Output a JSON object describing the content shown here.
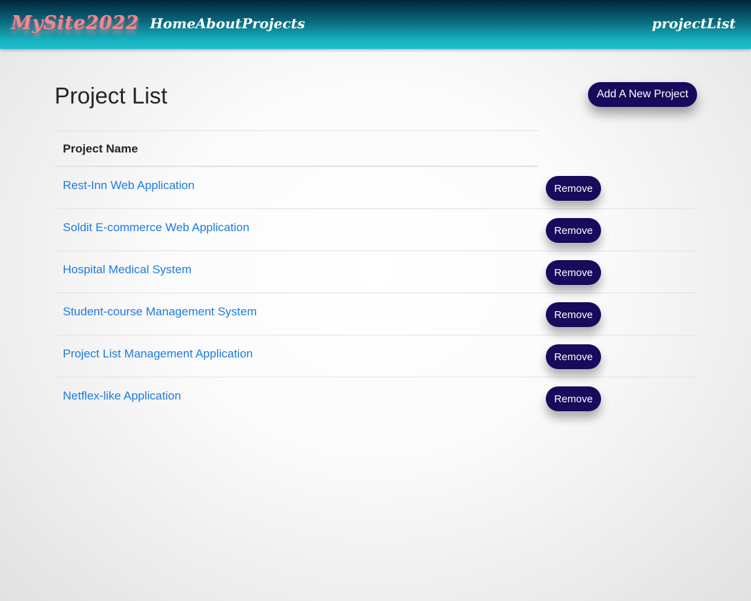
{
  "navbar": {
    "brand": "MySite2022",
    "links": [
      "Home",
      "About",
      "Projects"
    ],
    "right_label": "projectList"
  },
  "page": {
    "title": "Project List",
    "add_button": "Add A New Project"
  },
  "table": {
    "header": "Project Name",
    "rows": [
      {
        "name": "Rest-Inn Web Application",
        "action": "Remove"
      },
      {
        "name": "Soldit E-commerce Web Application",
        "action": "Remove"
      },
      {
        "name": "Hospital Medical System",
        "action": "Remove"
      },
      {
        "name": "Student-course Management System",
        "action": "Remove"
      },
      {
        "name": "Project List Management Application",
        "action": "Remove"
      },
      {
        "name": "Netflex-like Application",
        "action": "Remove"
      }
    ]
  },
  "colors": {
    "button": "#170b5c",
    "link": "#1e7be0",
    "brand": "#e88b96"
  }
}
